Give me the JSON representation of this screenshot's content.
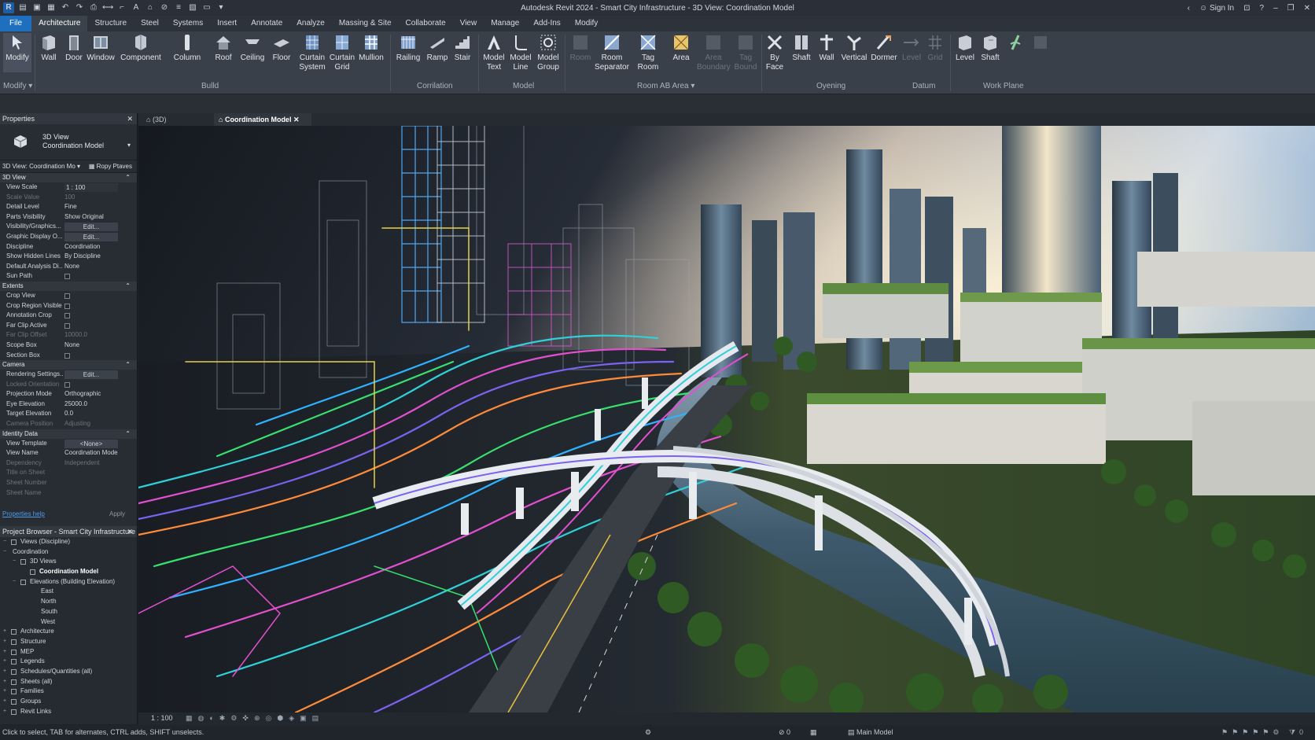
{
  "window": {
    "title": "Autodesk Revit 2024 - Smart City Infrastructure - 3D View: Coordination Model",
    "sign_in": "Sign In"
  },
  "menu": [
    "File",
    "Architecture",
    "Structure",
    "Steel",
    "Systems",
    "Insert",
    "Annotate",
    "Analyze",
    "Massing & Site",
    "Collaborate",
    "View",
    "Manage",
    "Add-Ins",
    "Modify"
  ],
  "ribbon": {
    "buttons": {
      "modify": "Modify",
      "wall": "Wall",
      "door": "Door",
      "window": "Window",
      "component": "Component",
      "column": "Column",
      "roof": "Roof",
      "ceiling": "Ceiling",
      "floor": "Floor",
      "curtain_system_1": "Curtain",
      "curtain_system_2": "System",
      "curtain_grid_1": "Curtain",
      "curtain_grid_2": "Grid",
      "mullion": "Mullion",
      "railing": "Railing",
      "ramp": "Ramp",
      "stair": "Stair",
      "model_text_1": "Model",
      "model_text_2": "Text",
      "model_line_1": "Model",
      "model_line_2": "Line",
      "model_group_1": "Model",
      "model_group_2": "Group",
      "room": "Room",
      "room_sep_1": "Room",
      "room_sep_2": "Separator",
      "tag_room_1": "Tag",
      "tag_room_2": "Room",
      "area": "Area",
      "area_boundary_1": "Area",
      "area_boundary_2": "Boundary",
      "tag_area_1": "Tag",
      "tag_area_2": "Bound",
      "by_face_1": "By",
      "by_face_2": "Face",
      "shaft": "Shaft",
      "wall_op": "Wall",
      "vertical": "Vertical",
      "dormer": "Dormer",
      "level": "Level",
      "grid": "Grid",
      "level2": "Level",
      "shaft2": "Shaft"
    },
    "groups": {
      "select": "Modify",
      "build": "Bulld",
      "circulation": "Corrilation",
      "model": "Model",
      "room_area": "Room AB Area",
      "opening": "Oyening",
      "datum": "Datum",
      "work_plane": "Work Plane"
    }
  },
  "properties": {
    "header": "Properties",
    "type_line1": "3D View",
    "type_line2": "Coordination Model",
    "selector": "3D View: Coordination Mo",
    "edit_type": "Ropy Ptaves",
    "categories": {
      "graphics": "3D View",
      "extents": "Extents",
      "camera": "Camera",
      "identity": "Identity Data"
    },
    "rows": {
      "view_scale_k": "View Scale",
      "view_scale_v": "1 : 100",
      "scale_value_k": "Scale Value",
      "scale_value_v": "100",
      "detail_level_k": "Detail Level",
      "detail_level_v": "Fine",
      "parts_vis_k": "Parts Visibility",
      "parts_vis_v": "Show Original",
      "vis_graphics_k": "Visibility/Graphics...",
      "vis_graphics_v": "Edit...",
      "graphic_display_k": "Graphic Display O...",
      "graphic_display_v": "Edit...",
      "discipline_k": "Discipline",
      "discipline_v": "Coordination",
      "hidden_lines_k": "Show Hidden Lines",
      "hidden_lines_v": "By Discipline",
      "analysis_k": "Default Analysis Di...",
      "analysis_v": "None",
      "sun_path_k": "Sun Path",
      "crop_view_k": "Crop View",
      "crop_region_k": "Crop Region Visible",
      "annotation_crop_k": "Annotation Crop",
      "far_clip_k": "Far Clip Active",
      "far_clip_off_k": "Far Clip Offset",
      "far_clip_off_v": "10000.0",
      "scope_box_k": "Scope Box",
      "scope_box_v": "None",
      "section_box_k": "Section Box",
      "rendering_k": "Rendering Settings...",
      "rendering_v": "Edit...",
      "locked_k": "Locked Orientation",
      "projection_k": "Projection Mode",
      "projection_v": "Orthographic",
      "eye_k": "Eye Elevation",
      "eye_v": "25000.0",
      "target_k": "Target Elevation",
      "target_v": "0.0",
      "cam_pos_k": "Camera Position",
      "cam_pos_v": "Adjusting",
      "template_k": "View Template",
      "template_v": "<None>",
      "view_name_k": "View Name",
      "view_name_v": "Coordination Mode",
      "dependency_k": "Dependency",
      "dependency_v": "Independent",
      "title_sheet_k": "Title on Sheet",
      "sheet_number_k": "Sheet Number",
      "sheet_name_k": "Sheet Name"
    },
    "help": "Properties help",
    "apply": "Apply"
  },
  "browser": {
    "header": "Project Browser - Smart City Infrastructure",
    "items": [
      "Views (Discipline)",
      "Coordination",
      "3D Views",
      "Coordination Model",
      "Elevations (Building Elevation)",
      "East",
      "North",
      "South",
      "West",
      "Architecture",
      "Structure",
      "MEP",
      "Legends",
      "Schedules/Quantities (all)",
      "Sheets (all)",
      "Families",
      "Groups",
      "Revit Links"
    ]
  },
  "view_tabs": [
    "(3D)",
    "Coordination Model"
  ],
  "view_control": {
    "scale": "1 : 100"
  },
  "status": {
    "message": "Click to select, TAB for alternates, CTRL adds, SHIFT unselects.",
    "zero": "0",
    "model": "Main Model",
    "filter": "0"
  }
}
